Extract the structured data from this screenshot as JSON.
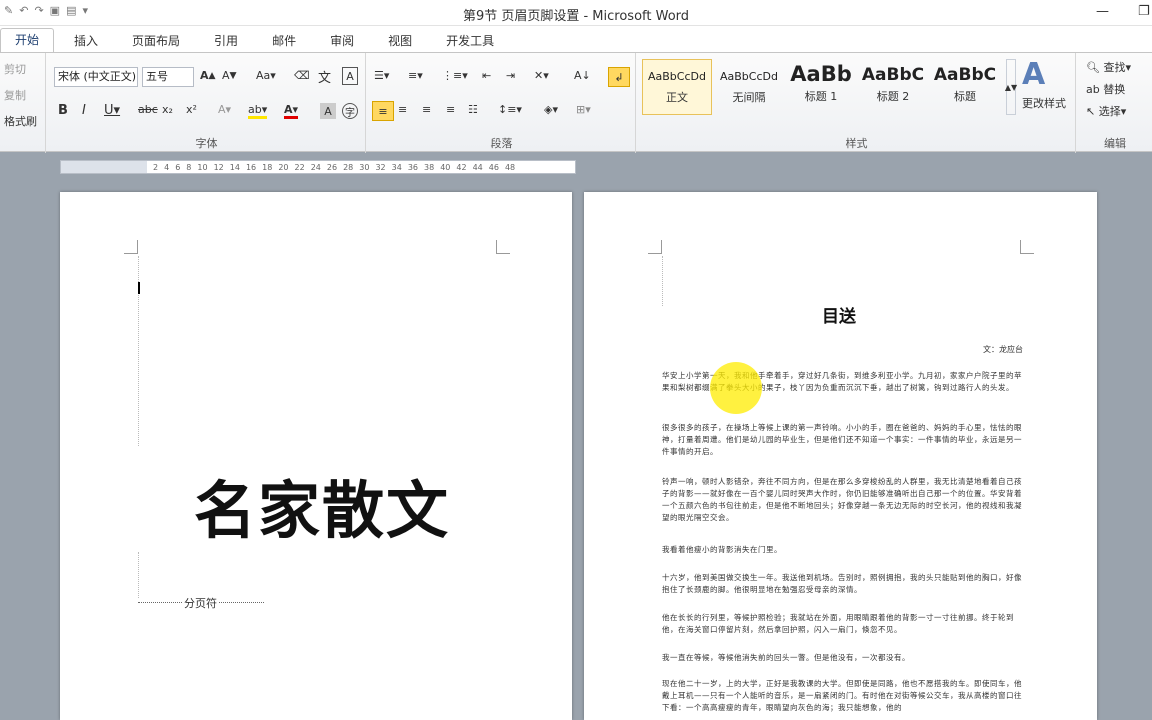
{
  "window": {
    "title": "第9节 页眉页脚设置 - Microsoft Word"
  },
  "tabs": [
    "开始",
    "插入",
    "页面布局",
    "引用",
    "邮件",
    "审阅",
    "视图",
    "开发工具"
  ],
  "clipboard": {
    "items": [
      "剪切",
      "复制",
      "格式刷"
    ]
  },
  "font": {
    "family": "宋体 (中文正文)",
    "size": "五号",
    "group_label": "字体"
  },
  "paragraph": {
    "group_label": "段落"
  },
  "styles": {
    "items": [
      {
        "sample": "AaBbCcDd",
        "name": "正文"
      },
      {
        "sample": "AaBbCcDd",
        "name": "无间隔"
      },
      {
        "sample": "AaBb",
        "name": "标题 1"
      },
      {
        "sample": "AaBbC",
        "name": "标题 2"
      },
      {
        "sample": "AaBbC",
        "name": "标题"
      }
    ],
    "change_label": "更改样式",
    "group_label": "样式"
  },
  "editing": {
    "find": "查找",
    "replace": "替换",
    "select": "选择",
    "group_label": "编辑"
  },
  "ruler": {
    "ticks": [
      "2",
      "4",
      "6",
      "8",
      "10",
      "12",
      "14",
      "16",
      "18",
      "20",
      "22",
      "24",
      "26",
      "28",
      "30",
      "32",
      "34",
      "36",
      "38",
      "40",
      "42",
      "44",
      "46",
      "48"
    ]
  },
  "page1": {
    "big_title": "名家散文",
    "page_break": "分页符"
  },
  "page2": {
    "essay_title": "目送",
    "author": "文：龙应台",
    "paragraphs": [
      "华安上小学第一天，我和他手牵着手，穿过好几条街，到维多利亚小学。九月初，家家户户院子里的苹果和梨树都缀满了拳头大小的果子，枝丫因为负重而沉沉下垂，越出了树篱，钩到过路行人的头发。",
      "很多很多的孩子，在操场上等候上课的第一声铃响。小小的手，圈在爸爸的、妈妈的手心里，怯怯的眼神，打量着周遭。他们是幼儿园的毕业生，但是他们还不知道一个事实：一件事情的毕业，永远是另一件事情的开启。",
      "铃声一响，顿时人影错杂，奔往不同方向，但是在那么多穿梭纷乱的人群里，我无比清楚地看着自己孩子的背影——就好像在一百个婴儿同时哭声大作时，你仍旧能够准确听出自己那一个的位置。华安背着一个五颜六色的书包往前走，但是他不断地回头；好像穿越一条无边无际的时空长河，他的视线和我凝望的眼光隔空交会。",
      "我看着他瘦小的背影消失在门里。",
      "十六岁，他到美国做交换生一年。我送他到机场。告别时，照例拥抱，我的头只能贴到他的胸口，好像抱住了长颈鹿的脚。他很明显地在勉强忍受母亲的深情。",
      "他在长长的行列里，等候护照检验；我就站在外面，用眼睛跟着他的背影一寸一寸往前挪。终于轮到他，在海关窗口停留片刻，然后拿回护照，闪入一扇门，倏忽不见。",
      "我一直在等候，等候他消失前的回头一瞥。但是他没有，一次都没有。",
      "现在他二十一岁，上的大学，正好是我教课的大学。但即使是同路，他也不愿搭我的车。即使同车，他戴上耳机——只有一个人能听的音乐，是一扇紧闭的门。有时他在对街等候公交车，我从高楼的窗口往下看：一个高高瘦瘦的青年，眼睛望向灰色的海；我只能想象，他的"
    ]
  }
}
